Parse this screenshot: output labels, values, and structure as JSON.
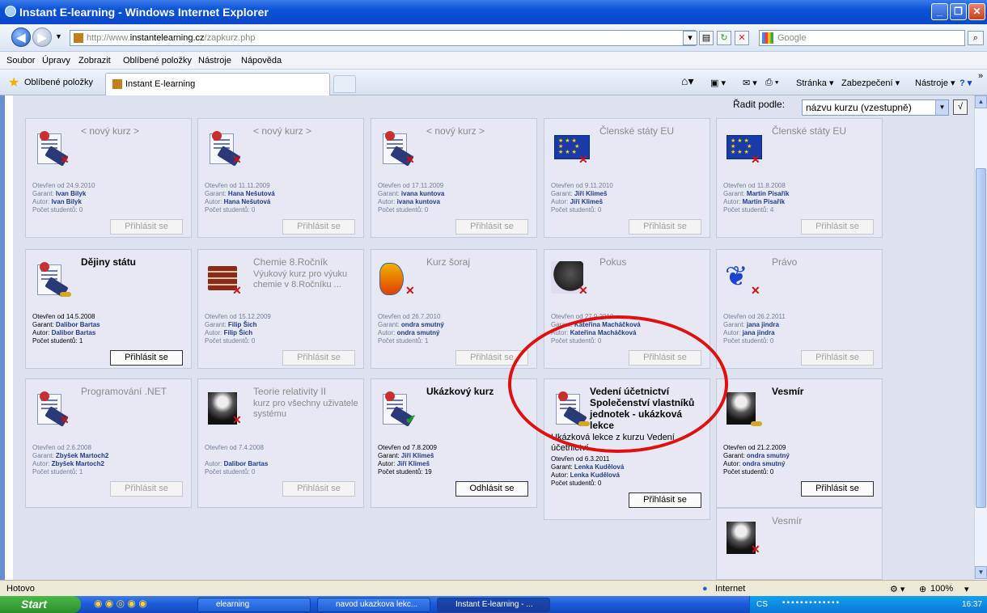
{
  "window": {
    "title": "Instant E-learning - Windows Internet Explorer"
  },
  "address": {
    "prefix": "http://www.",
    "domain": "instantelearning.cz",
    "path": "/zapkurz.php",
    "search_placeholder": "Google"
  },
  "menu": [
    "Soubor",
    "Úpravy",
    "Zobrazit",
    "Oblíbené položky",
    "Nástroje",
    "Nápověda"
  ],
  "favbar": {
    "favorites": "Oblíbené položky",
    "tab_title": "Instant E-learning"
  },
  "commandbar": [
    "Stránka ▾",
    "Zabezpečení ▾",
    "Nástroje ▾"
  ],
  "sort": {
    "label": "Řadit podle:",
    "value": "názvu kurzu (vzestupně)"
  },
  "labels": {
    "opened": "Otevřen od",
    "guarantor": "Garant:",
    "author": "Autor:",
    "students": "Počet studentů:"
  },
  "courses": [
    {
      "title": "< nový kurz >",
      "opened": "24.9.2010",
      "garant": "Ivan Bilyk",
      "author": "Ivan Bilyk",
      "students": "0",
      "button": "Přihlásit se",
      "state": "closed",
      "icon": "course-book-icon"
    },
    {
      "title": "< nový kurz >",
      "opened": "11.11.2009",
      "garant": "Hana Nešutová",
      "author": "Hana Nešutová",
      "students": "0",
      "button": "Přihlásit se",
      "state": "closed",
      "icon": "course-book-icon"
    },
    {
      "title": "< nový kurz >",
      "opened": "17.11.2009",
      "garant": "ivana kuntova",
      "author": "ivana kuntova",
      "students": "0",
      "button": "Přihlásit se",
      "state": "closed",
      "icon": "course-book-icon"
    },
    {
      "title": "Členské státy EU",
      "opened": "9.11.2010",
      "garant": "Jiří Klimeš",
      "author": "Jiří Klimeš",
      "students": "0",
      "button": "Přihlásit se",
      "state": "closed",
      "icon": "eu-flag-icon"
    },
    {
      "title": "Členské státy EU",
      "opened": "11.8.2008",
      "garant": "Martin Pisařík",
      "author": "Martin Pisařík",
      "students": "4",
      "button": "Přihlásit se",
      "state": "closed",
      "icon": "eu-flag-icon"
    },
    {
      "title": "Dějiny státu",
      "opened": "14.5.2008",
      "garant": "Dalibor Bartas",
      "author": "Dalibor Bartas",
      "students": "1",
      "button": "Přihlásit se",
      "state": "open",
      "icon": "course-book-icon"
    },
    {
      "title": "Chemie 8.Ročník",
      "desc": "Výukový kurz pro výuku chemie v 8.Ročníku ...",
      "opened": "15.12.2009",
      "garant": "Filip Šich",
      "author": "Filip Šich",
      "students": "0",
      "button": "Přihlásit se",
      "state": "closed",
      "icon": "books-stack-icon"
    },
    {
      "title": "Kurz šoraj",
      "opened": "26.7.2010",
      "garant": "ondra smutný",
      "author": "ondra smutný",
      "students": "1",
      "button": "Přihlásit se",
      "state": "closed",
      "icon": "fish-icon"
    },
    {
      "title": "Pokus",
      "opened": "27.9.2010",
      "garant": "Kateřina Macháčková",
      "author": "Kateřina Macháčková",
      "students": "0",
      "button": "Přihlásit se",
      "state": "closed",
      "icon": "horse-icon"
    },
    {
      "title": "Právo",
      "opened": "26.2.2011",
      "garant": "jana jindra",
      "author": "jana jindra",
      "students": "0",
      "button": "Přihlásit se",
      "state": "closed",
      "icon": "butterfly-icon"
    },
    {
      "title": "Programování .NET",
      "opened": "2.6.2008",
      "garant": "Zbyšek Martoch2",
      "author": "Zbyšek Martoch2",
      "students": "1",
      "button": "Přihlásit se",
      "state": "closed",
      "icon": "course-book-icon"
    },
    {
      "title": "Teorie relativity II",
      "desc": "kurz pro všechny uživatele systému",
      "opened": "7.4.2008",
      "garant": "",
      "author": "Dalibor Bartas",
      "students": "0",
      "button": "Přihlásit se",
      "state": "closed",
      "icon": "astronaut-icon"
    },
    {
      "title": "Ukázkový kurz",
      "opened": "7.8.2009",
      "garant": "Jiří Klimeš",
      "author": "Jiří Klimeš",
      "students": "19",
      "button": "Odhlásit se",
      "state": "enrolled",
      "icon": "course-book-icon"
    },
    {
      "title": "Vedení účetnictví Společenství vlastníků jednotek - ukázková lekce",
      "desc": "Ukázková lekce z kurzu Vedení účetnictví ...",
      "opened": "6.3.2011",
      "garant": "Lenka Kudělová",
      "author": "Lenka Kudělová",
      "students": "0",
      "button": "Přihlásit se",
      "state": "open",
      "icon": "course-book-icon"
    },
    {
      "title": "Vesmír",
      "opened": "21.2.2009",
      "garant": "ondra smutný",
      "author": "ondra smutný",
      "students": "0",
      "button": "Přihlásit se",
      "state": "open",
      "icon": "astronaut-icon"
    },
    {
      "title": "Vesmír",
      "state": "closed",
      "icon": "astronaut-icon"
    }
  ],
  "status": {
    "left": "Hotovo",
    "zone": "Internet",
    "zoom": "100%"
  },
  "taskbar": {
    "start": "Start",
    "tasks": [
      "elearning",
      "navod ukazkova lekc...",
      "Instant E-learning - ..."
    ],
    "lang": "CS",
    "clock": "16:37"
  },
  "colors": {
    "highlight_ellipse": "#e01010",
    "titlebar": "#0a52d8"
  }
}
